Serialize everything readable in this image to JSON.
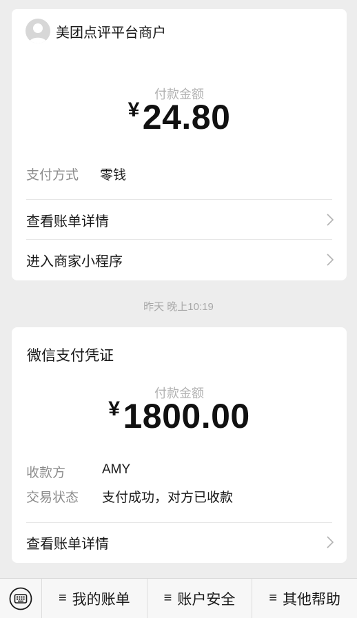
{
  "card1": {
    "merchant_name": "美团点评平台商户",
    "amount_label": "付款金额",
    "currency": "¥",
    "amount": "24.80",
    "payment_method_label": "支付方式",
    "payment_method_value": "零钱",
    "links": [
      {
        "label": "查看账单详情"
      },
      {
        "label": "进入商家小程序"
      }
    ]
  },
  "timestamp": "昨天 晚上10:19",
  "card2": {
    "title": "微信支付凭证",
    "amount_label": "付款金额",
    "currency": "¥",
    "amount": "1800.00",
    "payee_label": "收款方",
    "payee_value": "AMY",
    "status_label": "交易状态",
    "status_value": "支付成功，对方已收款",
    "links": [
      {
        "label": "查看账单详情"
      }
    ]
  },
  "bottom_menu": {
    "keyboard_icon": "keyboard-icon",
    "items": [
      {
        "label": "我的账单"
      },
      {
        "label": "账户安全"
      },
      {
        "label": "其他帮助"
      }
    ]
  }
}
